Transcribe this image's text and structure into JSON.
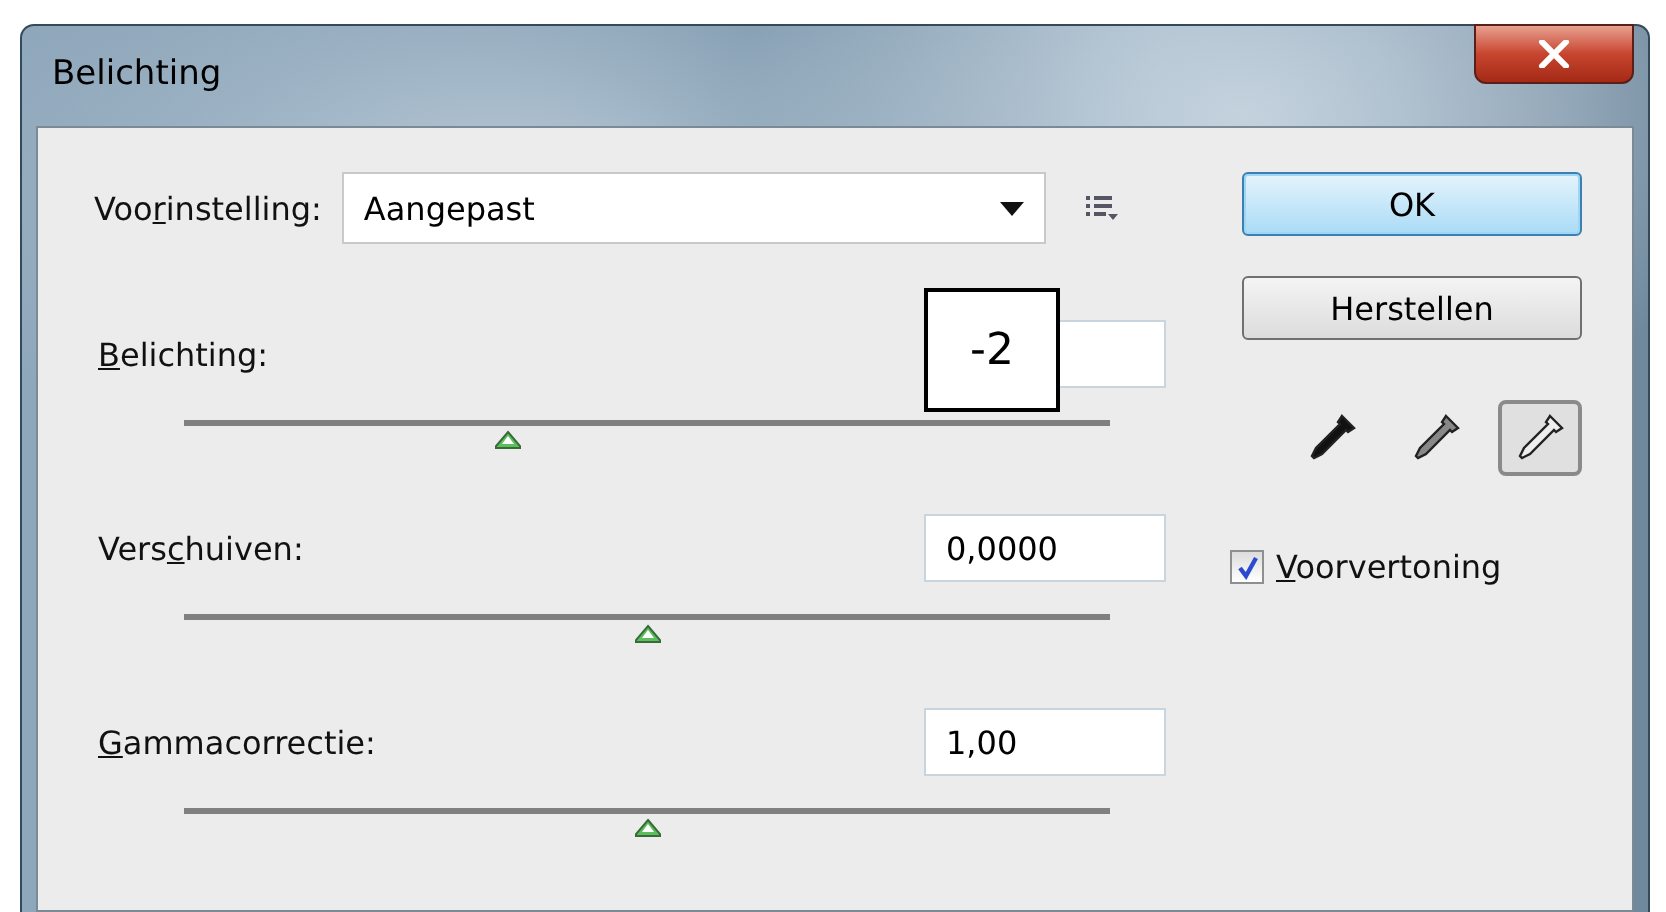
{
  "window": {
    "title": "Belichting"
  },
  "preset": {
    "label": {
      "pre": "Voo",
      "key": "r",
      "post": "instelling:"
    },
    "value": "Aangepast"
  },
  "sliders": [
    {
      "label": {
        "key": "B",
        "post": "elichting:"
      },
      "level": 0.35
    },
    {
      "label": {
        "pre": "Vers",
        "key": "c",
        "post": "huiven:"
      },
      "value": "0,0000",
      "level": 0.5
    },
    {
      "label": {
        "key": "G",
        "post": "ammacorrectie:"
      },
      "value": "1,00",
      "level": 0.5
    }
  ],
  "buttons": [
    {
      "label": "OK",
      "default": true
    },
    {
      "label": "Herstellen",
      "default": false
    }
  ],
  "eyedroppers": [
    {
      "kind": "black",
      "selected": false
    },
    {
      "kind": "gray",
      "selected": false
    },
    {
      "kind": "white",
      "selected": true
    }
  ],
  "preview": {
    "label": {
      "key": "V",
      "post": "oorvertoning"
    },
    "checked": true
  },
  "callout": "-2"
}
